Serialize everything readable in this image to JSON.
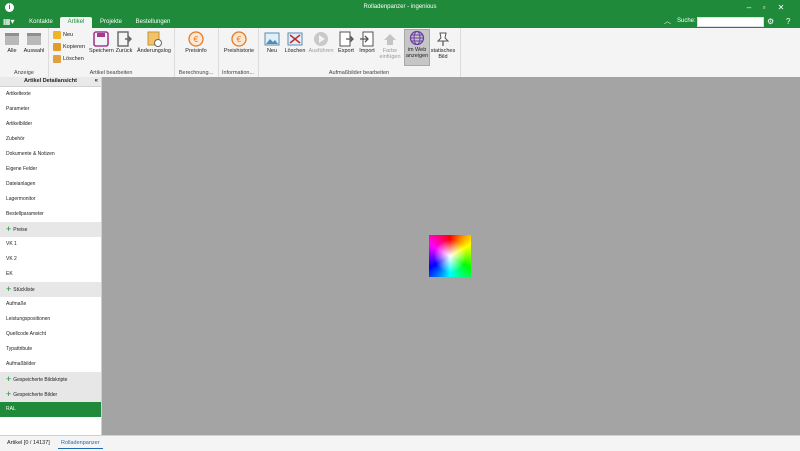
{
  "window": {
    "title": "Rolladenpanzer - ingenious",
    "logo": "ingenious-logo-icon",
    "controls": [
      "minimize-icon",
      "restore-icon",
      "close-icon"
    ]
  },
  "tabs": {
    "menu_icon": "grid-menu-icon",
    "items": [
      {
        "label": "Kontakte"
      },
      {
        "label": "Artikel"
      },
      {
        "label": "Projekte"
      },
      {
        "label": "Bestellungen"
      }
    ],
    "active": "Artikel",
    "search": {
      "label": "Suche:",
      "value": "",
      "placeholder": ""
    },
    "right_icons": [
      "ribbon-collapse-icon",
      "settings-icon",
      "help-icon"
    ]
  },
  "ribbon": {
    "groups": [
      {
        "label": "Anzeige",
        "buttons": [
          {
            "label": "Alle"
          },
          {
            "label": "Auswahl"
          }
        ]
      },
      {
        "label": "Artikel bearbeiten",
        "small_buttons": [
          {
            "label": "Neu"
          },
          {
            "label": "Kopieren"
          },
          {
            "label": "Löschen"
          }
        ],
        "buttons": [
          {
            "label": "Speichern"
          },
          {
            "label": "Zurück"
          },
          {
            "label": "Änderungslog"
          }
        ]
      },
      {
        "label": "Berechnung...",
        "buttons": [
          {
            "label": "Preisinfo"
          }
        ]
      },
      {
        "label": "Information...",
        "buttons": [
          {
            "label": "Preishistorie"
          }
        ]
      },
      {
        "label": "Aufmaßbilder bearbeiten",
        "buttons": [
          {
            "label": "Neu"
          },
          {
            "label": "Löschen"
          },
          {
            "label": "Ausführen"
          },
          {
            "label": "Export"
          },
          {
            "label": "Import"
          },
          {
            "label_line1": "Farbe",
            "label_line2": "einfügen"
          },
          {
            "label_line1": "im Web",
            "label_line2": "anzeigen"
          },
          {
            "label_line1": "statisches",
            "label_line2": "Bild"
          }
        ]
      }
    ]
  },
  "sidebar": {
    "header": "Artikel Detailansicht",
    "collapse_icon": "double-chevron-left-icon",
    "items": [
      {
        "label": "Artikeltexte",
        "type": "item"
      },
      {
        "label": "Parameter",
        "type": "item"
      },
      {
        "label": "Artikelbilder",
        "type": "item"
      },
      {
        "label": "Zubehör",
        "type": "item"
      },
      {
        "label": "Dokumente & Notizen",
        "type": "item"
      },
      {
        "label": "Eigene Felder",
        "type": "item"
      },
      {
        "label": "Dateianlagen",
        "type": "item"
      },
      {
        "label": "Lagermonitor",
        "type": "item"
      },
      {
        "label": "Bestellparameter",
        "type": "item"
      },
      {
        "label": "Preise",
        "type": "group"
      },
      {
        "label": "VK 1",
        "type": "item"
      },
      {
        "label": "VK 2",
        "type": "item"
      },
      {
        "label": "EK",
        "type": "item"
      },
      {
        "label": "Stückliste",
        "type": "group"
      },
      {
        "label": "Aufmaße",
        "type": "item"
      },
      {
        "label": "Leistungspositionen",
        "type": "item"
      },
      {
        "label": "Quellcode Ansicht",
        "type": "item"
      },
      {
        "label": "Typattribute",
        "type": "item"
      },
      {
        "label": "Aufmaßbilder",
        "type": "item"
      },
      {
        "label": "Gespeicherte Bildskripte",
        "type": "group"
      },
      {
        "label": "Gespeicherte Bilder",
        "type": "group"
      },
      {
        "label": "RAL",
        "type": "item",
        "selected": true
      }
    ]
  },
  "main": {
    "preview": "color-wheel-image",
    "background": "#a4a4a4"
  },
  "status": {
    "tabs": [
      {
        "label": "Artikel [0 / 14137]"
      },
      {
        "label": "Rolladenpanzer"
      }
    ],
    "active": "Rolladenpanzer"
  },
  "colors": {
    "accent": "#1f8a3a",
    "selected_bg": "#1f8a3a",
    "status_link": "#1f6ab0"
  }
}
